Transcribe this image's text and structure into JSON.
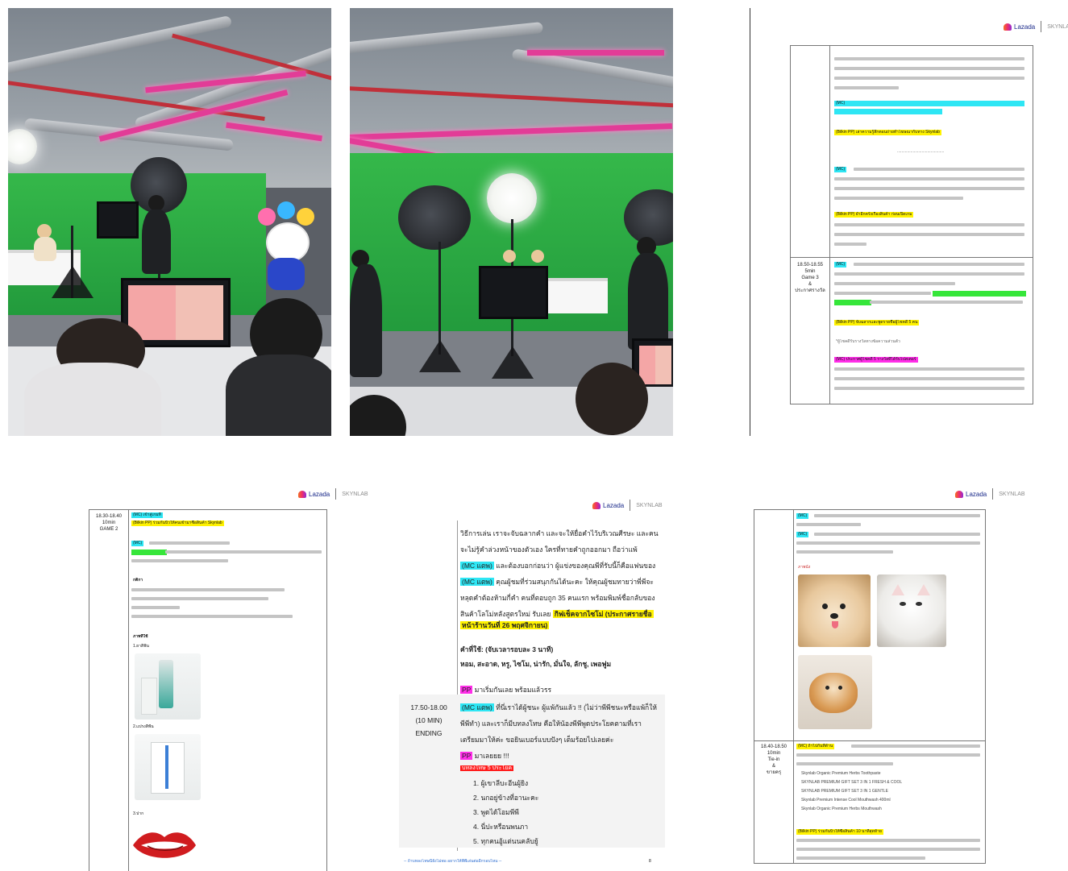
{
  "brand": {
    "name": "Lazada",
    "sub": "SKYNLAB"
  },
  "photos": {
    "p1": {
      "alt": "studio-photo-1"
    },
    "p2": {
      "alt": "studio-photo-2"
    }
  },
  "doc_top_right": {
    "row_time": [
      "18.50-18.55",
      "5min",
      "Game 3",
      "&",
      "ประกาศรางวัล"
    ],
    "labels": {
      "mc1": "(MC)",
      "bilkin1": "(Bilkin PP) เล่าความรู้สึกตอนถ่ายทำโฆษณากับทาง Skynlab",
      "divider": "..........................................",
      "mc2": "(MC)",
      "bilkin2": "(Bilkin PP) ย้ำอีกครั้งเรื่องสินค้า ก่อนเปิดเกม",
      "mc3": "(MC)",
      "bilkin3": "(Bilkin PP) จับฉลากและพูดรายชื่อผู้โชคดี 5 คน",
      "mc4": "(MC) ประกาศผู้โชคดี 5 รางวัลที่ได้รับโปสเตอร์",
      "note": "*ผู้โชคดีรับรางวัลทางข้อความส่วนตัว"
    }
  },
  "doc_bottom_left": {
    "row_time": [
      "18.30-18.40",
      "10min",
      "GAME 2"
    ],
    "labels": {
      "mc1": "(MC) เข้าสู่เกมที่",
      "bilkin1": "(Bilkin PP) ร่วมกันบิ้วให้คนเข้ามาซื้อสินค้า Skynlab",
      "mc2": "(MC)",
      "rules_title": "กติกา",
      "items_title": "ภาพที่ใช้",
      "item1": "1.ยาสีฟัน",
      "item2": "2.แปรงสีฟัน",
      "item3": "3.ปาก"
    }
  },
  "doc_bottom_mid": {
    "row_time": [
      "17.50-18.00",
      "(10 MIN)",
      "ENDING"
    ],
    "lines": {
      "l1": "วิธีการเล่น เราจะจับฉลากคำ และจะให้ยื่อคำไว้บริเวณศีรษะ และคน",
      "l2": "จะไม่รู้คำล่วงหน้าของตัวเอง ใครที่ทายคำถูกออกมา ถือว่าแพ้",
      "l3a": "(MC แตพ)",
      "l3b": "และต้องบอกก่อนว่า ผู้แข่งของคุณพีที่รับนี้ก็คือแฟนของ",
      "l4a": "(MC แตพ)",
      "l4b": "คุณผู้ชมที่ร่วมสนุกกันได้นะคะ ให้คุณผู้ชมทายว่าพี่พีจะ",
      "l5": "หลุดคำต้องห้ามกี่คำ คนที่ตอบถูก 35 คนแรก พร้อมพิมพ์ชื่อกลับของ",
      "l6a": "สินค้าโลโม่หลังสูตรใหม่ รับเลย",
      "l6b": "กิฟเช็คจากไซโม่ (ประกาศรายชื่อ",
      "l7": "หน้าร้านวันที่ 26 พฤศจิกายน)",
      "words_title": "คำที่ใช้: (จับเวลารอบละ 3 นาที)",
      "words": "หอม, สะอาด, หรู, ไซโม, น่ารัก, มั่นใจ, ลักชู, เพอฟูม",
      "pp1a": "PP",
      "pp1b": "มาเริ่มกันเลย พร้อมแล้วรร",
      "mc_a": "(MC แตพ)",
      "mc_b": "ที่นี่เราได้ผู้ชนะ ผู้แพ้กันแล้ว !! (ไม่ว่าพีพีชนะหรือแพ้ก็ให้",
      "mc_c": "พีพีทำ) และเราก็มีบทลงโทษ คือให้น้องพีพีพูดประโยคตามที่เรา",
      "mc_d": "เตรียมมาให้ค่ะ ขอยินเบอร์แบบปังๆ เต็มร้อยไปเลยค่ะ",
      "pp2a": "PP",
      "pp2b": "มาเลยยย !!!",
      "red": "บทลงโทษ 5 ประโยค",
      "list": [
        "1.  ผู้เขาลีบะอีนผู้ยิง",
        "2.  นกอยู่ข้างที่อานะคะ",
        "3.  พูดได้โอมพีพี",
        "4.  นี่ปะหรือนพนภา",
        "5.  ทุกคนอู้แต่นนคลับยู้"
      ],
      "footer": "-- ถ้าบทลงโทษนี้ยังไม่พอ อยากให้พีพีเล่นต่ออีกรอบไหม --",
      "page_no": "8"
    }
  },
  "doc_bottom_right": {
    "row_time": [
      "18.40-18.50",
      "10min",
      "Tie-in",
      "&",
      "ขายครุ"
    ],
    "labels": {
      "mc1": "(MC)",
      "mc2": "(MC)",
      "pics_title": "ภาพนัง",
      "mc3": "(MC) ถ้าไปกันที่ด้าน",
      "bilkin1": "(Bilkin PP) ร่วมกันบิ้วให้ซื้อสินค้า 10 นาทีสุดท้าย",
      "products": [
        "Skynlab Organic Premium Herbs Toothpaste",
        "SKYNLAB PREMIUM GIFT SET 3 IN 1 FRESH & COOL",
        "SKYNLAB PREMIUM GIFT SET 3 IN 1 GENTLE",
        "Skynlab Premium Intense Cool Mouthwash 400ml",
        "Skynlab Organic Premium Herbs Mouthwash"
      ]
    }
  }
}
